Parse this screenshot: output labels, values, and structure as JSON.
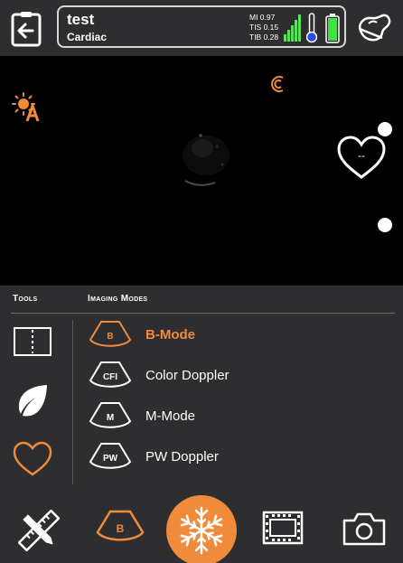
{
  "header": {
    "patient_name": "test",
    "preset": "Cardiac",
    "mi": "MI 0.97",
    "tis": "TIS 0.15",
    "tib": "TIB 0.28"
  },
  "image": {
    "heart_rate": "--"
  },
  "panel": {
    "tools_heading": "Tools",
    "modes_heading": "Imaging Modes",
    "modes": [
      {
        "icon": "B",
        "label": "B-Mode",
        "active": true
      },
      {
        "icon": "CFI",
        "label": "Color Doppler",
        "active": false
      },
      {
        "icon": "M",
        "label": "M-Mode",
        "active": false
      },
      {
        "icon": "PW",
        "label": "PW Doppler",
        "active": false
      }
    ]
  },
  "toolbar": {
    "bmode_icon": "B"
  },
  "colors": {
    "accent": "#f08b3c",
    "signal": "#5be05b",
    "battery": "#43e043",
    "thermometer": "#2b4fd8",
    "background": "#2e2e30"
  }
}
